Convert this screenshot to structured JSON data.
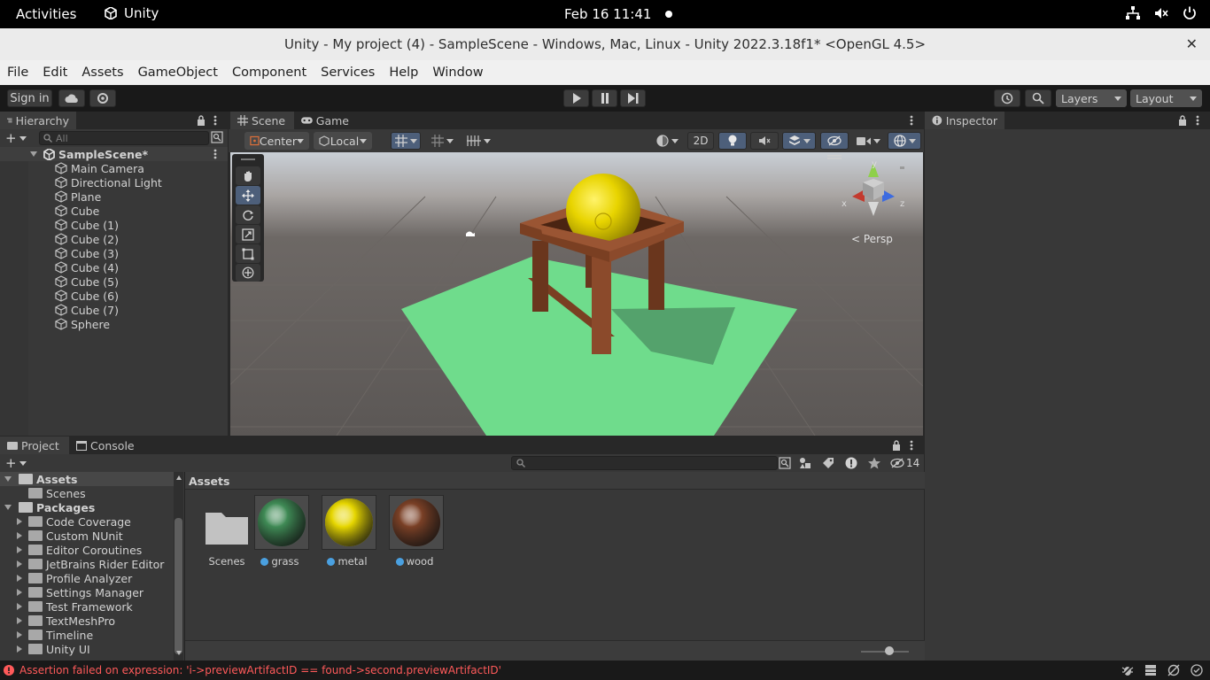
{
  "topbar": {
    "activities": "Activities",
    "app_name": "Unity",
    "clock": "Feb 16  11:41"
  },
  "window": {
    "title": "Unity - My project (4) - SampleScene - Windows, Mac, Linux - Unity 2022.3.18f1* <OpenGL 4.5>",
    "close": "✕"
  },
  "menu": [
    "File",
    "Edit",
    "Assets",
    "GameObject",
    "Component",
    "Services",
    "Help",
    "Window"
  ],
  "toolbar": {
    "sign_in": "Sign in",
    "layers": "Layers",
    "layout": "Layout"
  },
  "hierarchy": {
    "tab": "Hierarchy",
    "search_placeholder": "All",
    "scene": "SampleScene*",
    "items": [
      "Main Camera",
      "Directional Light",
      "Plane",
      "Cube",
      "Cube (1)",
      "Cube (2)",
      "Cube (3)",
      "Cube (4)",
      "Cube (5)",
      "Cube (6)",
      "Cube (7)",
      "Sphere"
    ]
  },
  "scene": {
    "tabs": [
      "Scene",
      "Game"
    ],
    "pivot": "Center",
    "space": "Local",
    "mode_2d": "2D",
    "persp": "Persp",
    "gizmo_axes": {
      "x": "x",
      "y": "y",
      "z": "z"
    }
  },
  "inspector": {
    "tab": "Inspector"
  },
  "project": {
    "tabs": [
      "Project",
      "Console"
    ],
    "breadcrumb": "Assets",
    "hidden_count": "14",
    "tree": {
      "assets": "Assets",
      "scenes": "Scenes",
      "packages": "Packages",
      "package_items": [
        "Code Coverage",
        "Custom NUnit",
        "Editor Coroutines",
        "JetBrains Rider Editor",
        "Profile Analyzer",
        "Settings Manager",
        "Test Framework",
        "TextMeshPro",
        "Timeline",
        "Unity UI"
      ]
    },
    "assets": [
      {
        "name": "Scenes",
        "kind": "folder"
      },
      {
        "name": "grass",
        "kind": "material",
        "color": "#3f8a55"
      },
      {
        "name": "metal",
        "kind": "material",
        "color": "#e6d600"
      },
      {
        "name": "wood",
        "kind": "material",
        "color": "#7a4026"
      }
    ]
  },
  "status": {
    "message": "Assertion failed on expression: 'i->previewArtifactID == found->second.previewArtifactID'"
  },
  "colors": {
    "accent": "#4f7bb7",
    "error": "#ff5a5a",
    "grass": "#6fdc8c",
    "wood": "#8b4a2b",
    "metal": "#f2d500"
  }
}
